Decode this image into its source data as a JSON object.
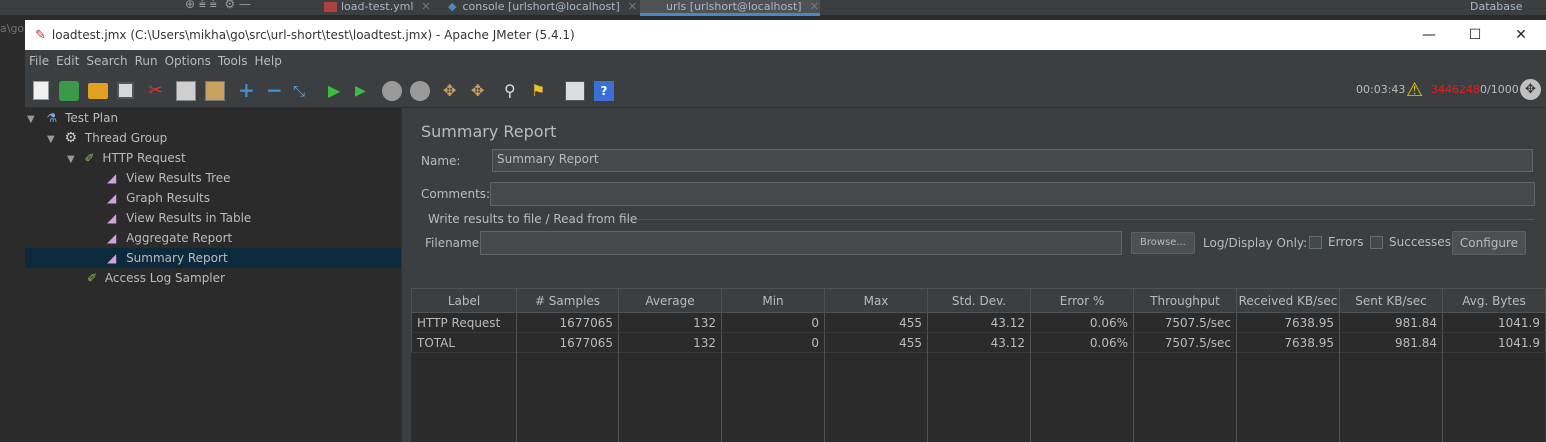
{
  "ide": {
    "tabs": [
      {
        "label": "load-test.yml"
      },
      {
        "label": "console [urlshort@localhost]"
      },
      {
        "label": "urls [urlshort@localhost]"
      }
    ],
    "right_label": "Database",
    "left_text": "a\\go"
  },
  "window": {
    "title": "loadtest.jmx (C:\\Users\\mikha\\go\\src\\url-short\\test\\loadtest.jmx) - Apache JMeter (5.4.1)",
    "min_glyph": "—",
    "max_glyph": "☐",
    "close_glyph": "✕"
  },
  "menu": [
    "File",
    "Edit",
    "Search",
    "Run",
    "Options",
    "Tools",
    "Help"
  ],
  "status": {
    "time": "00:03:43",
    "errors": "3446248",
    "threads": "0/1000"
  },
  "tree": {
    "items": [
      {
        "label": "Test Plan"
      },
      {
        "label": "Thread Group"
      },
      {
        "label": "HTTP Request"
      },
      {
        "label": "View Results Tree"
      },
      {
        "label": "Graph Results"
      },
      {
        "label": "View Results in Table"
      },
      {
        "label": "Aggregate Report"
      },
      {
        "label": "Summary Report"
      },
      {
        "label": "Access Log Sampler"
      }
    ]
  },
  "panel": {
    "heading": "Summary Report",
    "name_label": "Name:",
    "name_value": "Summary Report",
    "comments_label": "Comments:",
    "comments_value": "",
    "file_group": "Write results to file / Read from file",
    "filename_label": "Filename",
    "filename_value": "",
    "browse": "Browse...",
    "logdisplay": "Log/Display Only:",
    "errors": "Errors",
    "successes": "Successes",
    "configure": "Configure"
  },
  "table": {
    "headers": [
      "Label",
      "# Samples",
      "Average",
      "Min",
      "Max",
      "Std. Dev.",
      "Error %",
      "Throughput",
      "Received KB/sec",
      "Sent KB/sec",
      "Avg. Bytes"
    ],
    "rows": [
      [
        "HTTP Request",
        "1677065",
        "132",
        "0",
        "455",
        "43.12",
        "0.06%",
        "7507.5/sec",
        "7638.95",
        "981.84",
        "1041.9"
      ],
      [
        "TOTAL",
        "1677065",
        "132",
        "0",
        "455",
        "43.12",
        "0.06%",
        "7507.5/sec",
        "7638.95",
        "981.84",
        "1041.9"
      ]
    ]
  },
  "colors": {
    "selection": "#0d293e",
    "error_count": "#e02020",
    "accent_tab": "#4a88c7"
  }
}
